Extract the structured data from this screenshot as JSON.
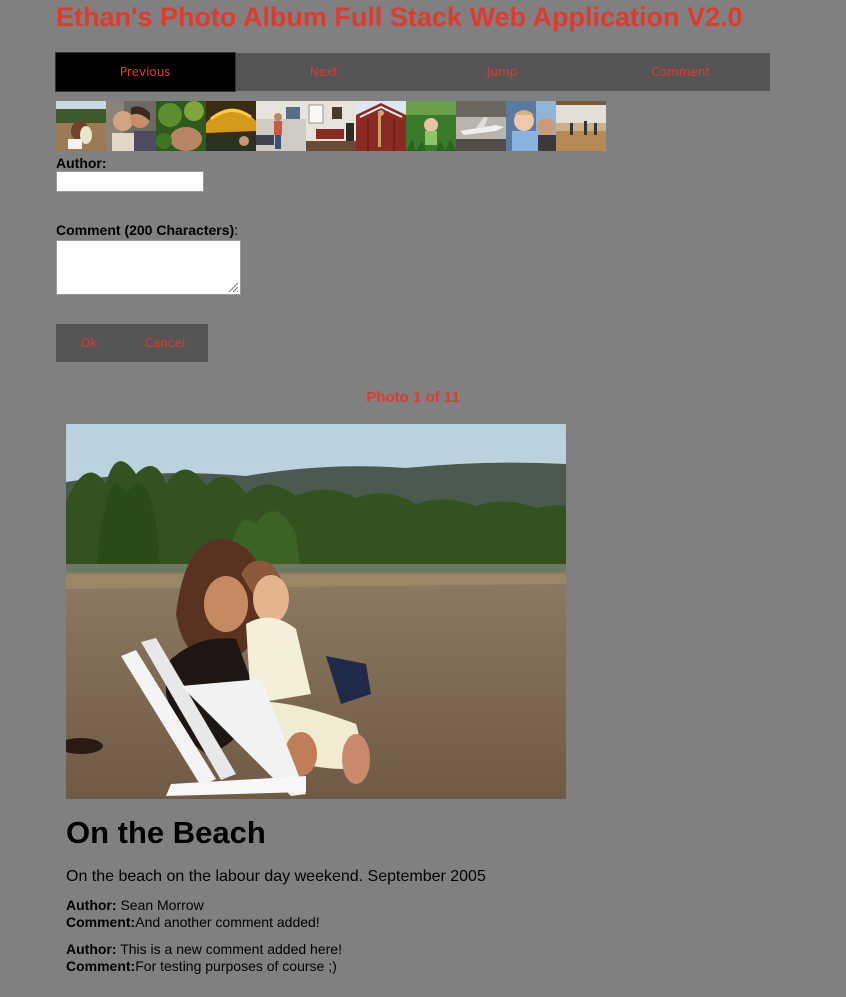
{
  "header": {
    "title": "Ethan's Photo Album Full Stack Web Application V2.0"
  },
  "nav": {
    "items": [
      {
        "label": "Previous",
        "active": true
      },
      {
        "label": "Next"
      },
      {
        "label": "Jump"
      },
      {
        "label": "Comment"
      }
    ]
  },
  "thumbnails_count": 11,
  "form": {
    "author_label": "Author:",
    "author_value": "",
    "comment_label": "Comment (200 Characters)",
    "comment_label_suffix": ":",
    "comment_value": "",
    "ok_label": "Ok",
    "cancel_label": "Cancel"
  },
  "photo": {
    "counter": "Photo 1 of 11",
    "title": "On the Beach",
    "description": "On the beach on the labour day weekend. September 2005"
  },
  "comments": [
    {
      "author_label": "Author:",
      "author": "Sean Morrow",
      "comment_label": "Comment:",
      "comment": "And another comment added!"
    },
    {
      "author_label": "Author:",
      "author": "This is a new comment added here!",
      "comment_label": "Comment:",
      "comment": "For testing purposes of course ;)"
    }
  ],
  "colors": {
    "background": "#808080",
    "accent": "#e03a2e",
    "bar": "#555555",
    "active": "#000000"
  }
}
